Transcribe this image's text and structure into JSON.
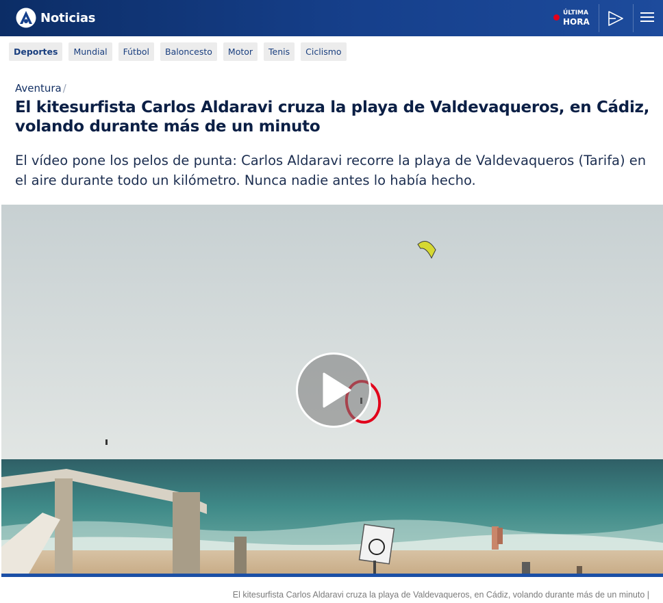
{
  "header": {
    "brand": "Noticias",
    "live_label_top": "ÚLTIMA",
    "live_label_bottom": "HORA",
    "colors": {
      "bar": "#16408c",
      "live_dot": "#e3001b"
    }
  },
  "subnav": {
    "items": [
      {
        "label": "Deportes",
        "active": true
      },
      {
        "label": "Mundial"
      },
      {
        "label": "Fútbol"
      },
      {
        "label": "Baloncesto"
      },
      {
        "label": "Motor"
      },
      {
        "label": "Tenis"
      },
      {
        "label": "Ciclismo"
      }
    ]
  },
  "article": {
    "section": "Aventura",
    "section_separator": "/",
    "title": "El kitesurfista Carlos Aldaravi cruza la playa de Valdevaqueros, en Cádiz, volando durante más de un minuto",
    "lead": "El vídeo pone los pelos de punta: Carlos Aldaravi recorre la playa de Valdevaqueros (Tarifa) en el aire durante todo un kilómetro. Nunca nadie antes lo había hecho.",
    "caption": "El kitesurfista Carlos Aldaravi cruza la playa de Valdevaqueros, en Cádiz, volando durante más de un minuto |"
  },
  "icons": {
    "brand_logo": "antena3-logo-icon",
    "live_dot": "live-dot-icon",
    "play_nav": "play-outline-icon",
    "menu": "hamburger-menu-icon",
    "video_play": "play-icon"
  }
}
